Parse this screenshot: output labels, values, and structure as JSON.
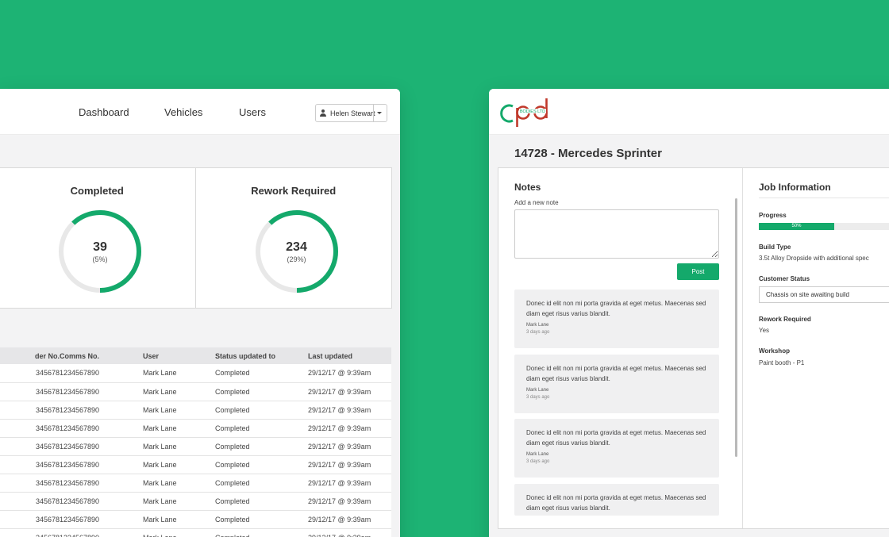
{
  "left": {
    "nav": {
      "dashboard": "Dashboard",
      "vehicles": "Vehicles",
      "users": "Users"
    },
    "user_menu": {
      "name": "Helen Stewart"
    },
    "stats": [
      {
        "title": "Completed",
        "count": "39",
        "pct": "(5%)",
        "ring_fraction": 0.62
      },
      {
        "title": "Rework Required",
        "count": "234",
        "pct": "(29%)",
        "ring_fraction": 0.62
      }
    ],
    "table": {
      "headers": [
        "der No.",
        "Comms No.",
        "User",
        "Status updated to",
        "Last updated"
      ],
      "rows": [
        [
          "345678",
          "1234567890",
          "Mark Lane",
          "Completed",
          "29/12/17 @ 9:39am"
        ],
        [
          "345678",
          "1234567890",
          "Mark Lane",
          "Completed",
          "29/12/17 @ 9:39am"
        ],
        [
          "345678",
          "1234567890",
          "Mark Lane",
          "Completed",
          "29/12/17 @ 9:39am"
        ],
        [
          "345678",
          "1234567890",
          "Mark Lane",
          "Completed",
          "29/12/17 @ 9:39am"
        ],
        [
          "345678",
          "1234567890",
          "Mark Lane",
          "Completed",
          "29/12/17 @ 9:39am"
        ],
        [
          "345678",
          "1234567890",
          "Mark Lane",
          "Completed",
          "29/12/17 @ 9:39am"
        ],
        [
          "345678",
          "1234567890",
          "Mark Lane",
          "Completed",
          "29/12/17 @ 9:39am"
        ],
        [
          "345678",
          "1234567890",
          "Mark Lane",
          "Completed",
          "29/12/17 @ 9:39am"
        ],
        [
          "345678",
          "1234567890",
          "Mark Lane",
          "Completed",
          "29/12/17 @ 9:39am"
        ],
        [
          "345678",
          "1234567890",
          "Mark Lane",
          "Completed",
          "29/12/17 @ 9:39am"
        ]
      ]
    }
  },
  "right": {
    "logo": {
      "letters": "cpd",
      "tagline": "BODIES LTD"
    },
    "job_title": "14728 - Mercedes Sprinter",
    "notes": {
      "heading": "Notes",
      "add_label": "Add a new note",
      "post_label": "Post",
      "items": [
        {
          "text": "Donec id elit non mi porta gravida at eget metus. Maecenas sed diam eget risus varius blandit.",
          "author": "Mark Lane",
          "time": "3 days ago"
        },
        {
          "text": "Donec id elit non mi porta gravida at eget metus. Maecenas sed diam eget risus varius blandit.",
          "author": "Mark Lane",
          "time": "3 days ago"
        },
        {
          "text": "Donec id elit non mi porta gravida at eget metus. Maecenas sed diam eget risus varius blandit.",
          "author": "Mark Lane",
          "time": "3 days ago"
        },
        {
          "text": "Donec id elit non mi porta gravida at eget metus. Maecenas sed diam eget risus varius blandit.",
          "author": "",
          "time": ""
        }
      ]
    },
    "job_info": {
      "heading": "Job Information",
      "progress_label": "Progress",
      "progress_value": 0.5,
      "progress_text": "50%",
      "build_type_label": "Build Type",
      "build_type": "3.5t Alloy Dropside with additional spec",
      "customer_status_label": "Customer Status",
      "customer_status": "Chassis on site awaiting build",
      "rework_label": "Rework Required",
      "rework": "Yes",
      "workshop_label": "Workshop",
      "workshop": "Paint booth - P1"
    }
  },
  "colors": {
    "background": "#1db374",
    "accent": "#14a96b",
    "logo_red": "#c0392b"
  }
}
